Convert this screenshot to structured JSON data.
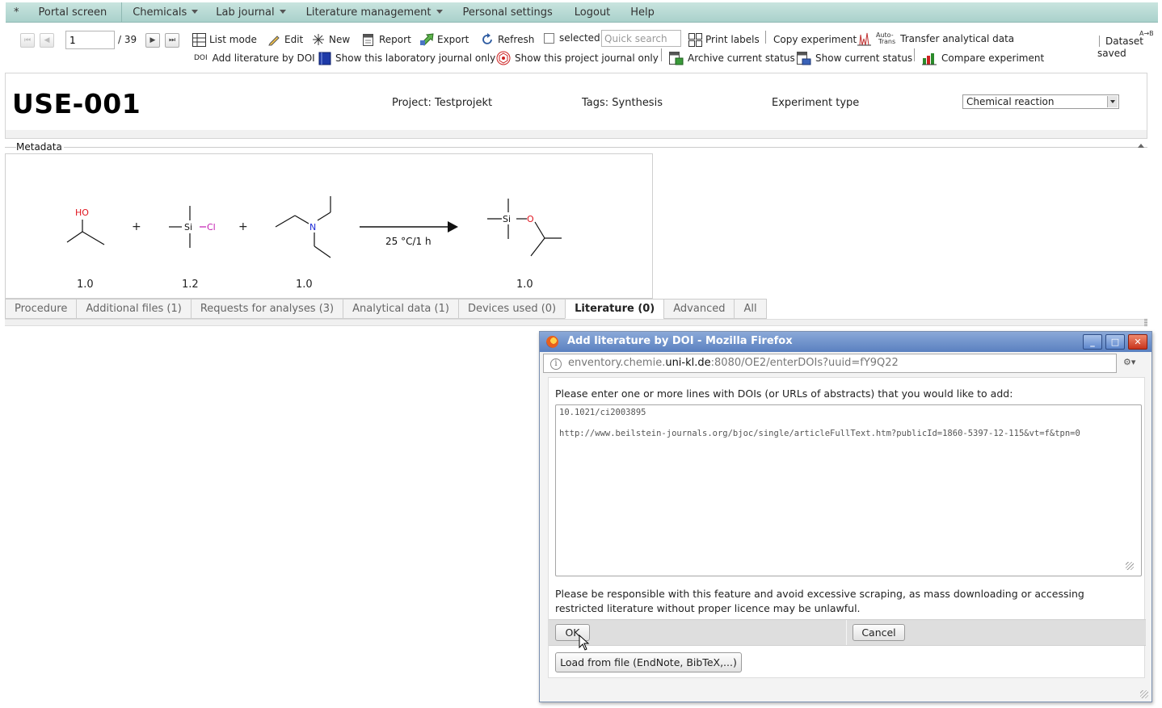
{
  "menubar": {
    "star": "*",
    "items": [
      {
        "label": "Portal screen"
      },
      {
        "label": "Chemicals"
      },
      {
        "label": "Lab journal"
      },
      {
        "label": "Literature management"
      },
      {
        "label": "Personal settings"
      },
      {
        "label": "Logout"
      },
      {
        "label": "Help"
      }
    ]
  },
  "toolbar": {
    "page_value": "1",
    "page_total": "/ 39",
    "list_mode": "List mode",
    "edit": "Edit",
    "new": "New",
    "report": "Report",
    "export": "Export",
    "refresh": "Refresh",
    "selected": "selected",
    "quick_search_placeholder": "Quick search",
    "print_labels": "Print labels",
    "copy_experiment": "Copy experiment",
    "auto_trans_top": "Auto-",
    "auto_trans_bottom": "Trans",
    "transfer_analytical": "Transfer analytical data",
    "dataset_status_line1": "Dataset",
    "dataset_status_line2": "saved",
    "doi_tag": "DOI",
    "add_literature_doi": "Add literature by DOI",
    "show_lab_journal": "Show this laboratory journal only",
    "show_project_journal": "Show this project journal only",
    "archive_status": "Archive current status",
    "show_status": "Show current status",
    "compare_experiment": "Compare experiment",
    "ab_mark": "A→B"
  },
  "header": {
    "code": "USE-001",
    "project": "Project: Testprojekt",
    "tags": "Tags: Synthesis",
    "experiment_type_label": "Experiment type",
    "experiment_type_value": "Chemical reaction"
  },
  "metadata": {
    "label": "Metadata"
  },
  "reaction": {
    "condition": "25 °C/1 h",
    "equivalents": [
      "1.0",
      "1.2",
      "1.0",
      "1.0"
    ],
    "plus": "+",
    "atoms": {
      "ho": "HO",
      "si": "Si",
      "cl": "Cl",
      "n": "N",
      "o": "O"
    }
  },
  "tabs": [
    {
      "label": "Procedure"
    },
    {
      "label": "Additional files (1)"
    },
    {
      "label": "Requests for analyses (3)"
    },
    {
      "label": "Analytical data (1)"
    },
    {
      "label": "Devices used (0)"
    },
    {
      "label": "Literature (0)"
    },
    {
      "label": "Advanced"
    },
    {
      "label": "All"
    }
  ],
  "popup": {
    "title": "Add literature by DOI - Mozilla Firefox",
    "url_prefix": "enventory.chemie.",
    "url_host": "uni-kl.de",
    "url_suffix": ":8080/OE2/enterDOIs?uuid=fY9Q22",
    "prompt": "Please enter one or more lines with DOIs (or URLs of abstracts) that you would like to add:",
    "textarea_value": "10.1021/ci2003895\n\nhttp://www.beilstein-journals.org/bjoc/single/articleFullText.htm?publicId=1860-5397-12-115&vt=f&tpn=0",
    "disclaimer": "Please be responsible with this feature and avoid excessive scraping, as mass downloading or accessing restricted literature without proper licence may be unlawful.",
    "ok_label": "OK",
    "cancel_label": "Cancel",
    "load_label": "Load from file (EndNote, BibTeX,...)",
    "min_label": "_",
    "max_label": "□",
    "close_label": "✕"
  },
  "colors": {
    "menubar": "#b9dcd6",
    "titlebar": "#5a80c0",
    "oxygen": "#e0141e",
    "nitrogen": "#1d2bd6",
    "chlorine": "#c21bb0"
  }
}
